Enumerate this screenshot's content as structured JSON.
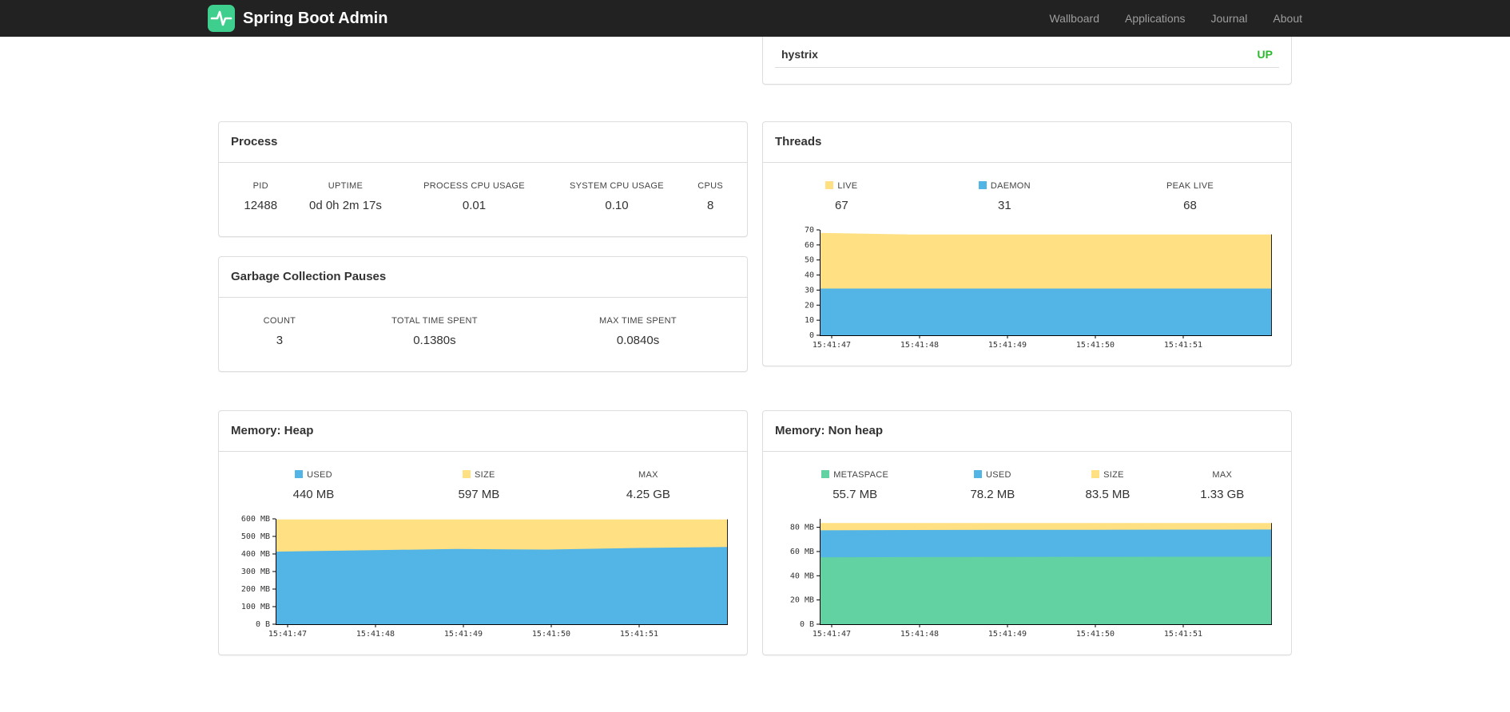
{
  "colors": {
    "brand_green": "#3ecf8e",
    "status_up": "#2db92d",
    "series_yellow": "#ffe082",
    "series_blue": "#53b5e6",
    "series_green": "#62d2a2"
  },
  "navbar": {
    "brand": "Spring Boot Admin",
    "items": [
      {
        "label": "Wallboard"
      },
      {
        "label": "Applications"
      },
      {
        "label": "Journal"
      },
      {
        "label": "About"
      }
    ]
  },
  "health": {
    "service": "hystrix",
    "status": "UP",
    "status_color": "#2db92d"
  },
  "process": {
    "title": "Process",
    "stats": [
      {
        "label": "PID",
        "value": "12488"
      },
      {
        "label": "UPTIME",
        "value": "0d 0h 2m 17s"
      },
      {
        "label": "PROCESS CPU USAGE",
        "value": "0.01"
      },
      {
        "label": "SYSTEM CPU USAGE",
        "value": "0.10"
      },
      {
        "label": "CPUS",
        "value": "8"
      }
    ]
  },
  "gc": {
    "title": "Garbage Collection Pauses",
    "stats": [
      {
        "label": "COUNT",
        "value": "3"
      },
      {
        "label": "TOTAL TIME SPENT",
        "value": "0.1380s"
      },
      {
        "label": "MAX TIME SPENT",
        "value": "0.0840s"
      }
    ]
  },
  "threads": {
    "title": "Threads",
    "stats": [
      {
        "label": "LIVE",
        "value": "67",
        "swatch": "#ffe082"
      },
      {
        "label": "DAEMON",
        "value": "31",
        "swatch": "#53b5e6"
      },
      {
        "label": "PEAK LIVE",
        "value": "68"
      }
    ],
    "chart": {
      "type": "area",
      "ymax_plot": 70,
      "yticks": [
        {
          "v": 0,
          "label": "0"
        },
        {
          "v": 10,
          "label": "10"
        },
        {
          "v": 20,
          "label": "20"
        },
        {
          "v": 30,
          "label": "30"
        },
        {
          "v": 40,
          "label": "40"
        },
        {
          "v": 50,
          "label": "50"
        },
        {
          "v": 60,
          "label": "60"
        },
        {
          "v": 70,
          "label": "70"
        }
      ],
      "xticks": [
        "15:41:47",
        "15:41:48",
        "15:41:49",
        "15:41:50",
        "15:41:51"
      ],
      "series": [
        {
          "name": "DAEMON",
          "color": "#53b5e6",
          "values": [
            31,
            31,
            31,
            31,
            31,
            31
          ]
        },
        {
          "name": "LIVE",
          "color": "#ffe082",
          "values": [
            68,
            67,
            67,
            67,
            67,
            67
          ]
        }
      ]
    }
  },
  "memory_heap": {
    "title": "Memory: Heap",
    "stats": [
      {
        "label": "USED",
        "value": "440 MB",
        "swatch": "#53b5e6"
      },
      {
        "label": "SIZE",
        "value": "597 MB",
        "swatch": "#ffe082"
      },
      {
        "label": "MAX",
        "value": "4.25 GB"
      }
    ],
    "chart": {
      "type": "area",
      "ymax_plot": 600,
      "yticks": [
        {
          "v": 0,
          "label": "0 B"
        },
        {
          "v": 100,
          "label": "100 MB"
        },
        {
          "v": 200,
          "label": "200 MB"
        },
        {
          "v": 300,
          "label": "300 MB"
        },
        {
          "v": 400,
          "label": "400 MB"
        },
        {
          "v": 500,
          "label": "500 MB"
        },
        {
          "v": 600,
          "label": "600 MB"
        }
      ],
      "xticks": [
        "15:41:47",
        "15:41:48",
        "15:41:49",
        "15:41:50",
        "15:41:51"
      ],
      "series": [
        {
          "name": "USED",
          "color": "#53b5e6",
          "values": [
            413,
            421,
            428,
            425,
            434,
            440
          ]
        },
        {
          "name": "SIZE",
          "color": "#ffe082",
          "values": [
            597,
            597,
            597,
            597,
            597,
            597
          ]
        }
      ]
    }
  },
  "memory_nonheap": {
    "title": "Memory: Non heap",
    "stats": [
      {
        "label": "METASPACE",
        "value": "55.7 MB",
        "swatch": "#62d2a2"
      },
      {
        "label": "USED",
        "value": "78.2 MB",
        "swatch": "#53b5e6"
      },
      {
        "label": "SIZE",
        "value": "83.5 MB",
        "swatch": "#ffe082"
      },
      {
        "label": "MAX",
        "value": "1.33 GB"
      }
    ],
    "chart": {
      "type": "area",
      "ymax_plot": 87,
      "yticks": [
        {
          "v": 0,
          "label": "0 B"
        },
        {
          "v": 20,
          "label": "20 MB"
        },
        {
          "v": 40,
          "label": "40 MB"
        },
        {
          "v": 60,
          "label": "60 MB"
        },
        {
          "v": 80,
          "label": "80 MB"
        }
      ],
      "xticks": [
        "15:41:47",
        "15:41:48",
        "15:41:49",
        "15:41:50",
        "15:41:51"
      ],
      "series": [
        {
          "name": "METASPACE",
          "color": "#62d2a2",
          "values": [
            55.2,
            55.4,
            55.5,
            55.6,
            55.7,
            55.7
          ]
        },
        {
          "name": "USED",
          "color": "#53b5e6",
          "values": [
            77.5,
            77.8,
            77.9,
            78.0,
            78.1,
            78.2
          ]
        },
        {
          "name": "SIZE",
          "color": "#ffe082",
          "values": [
            83.5,
            83.5,
            83.5,
            83.5,
            83.5,
            83.5
          ]
        }
      ]
    }
  }
}
